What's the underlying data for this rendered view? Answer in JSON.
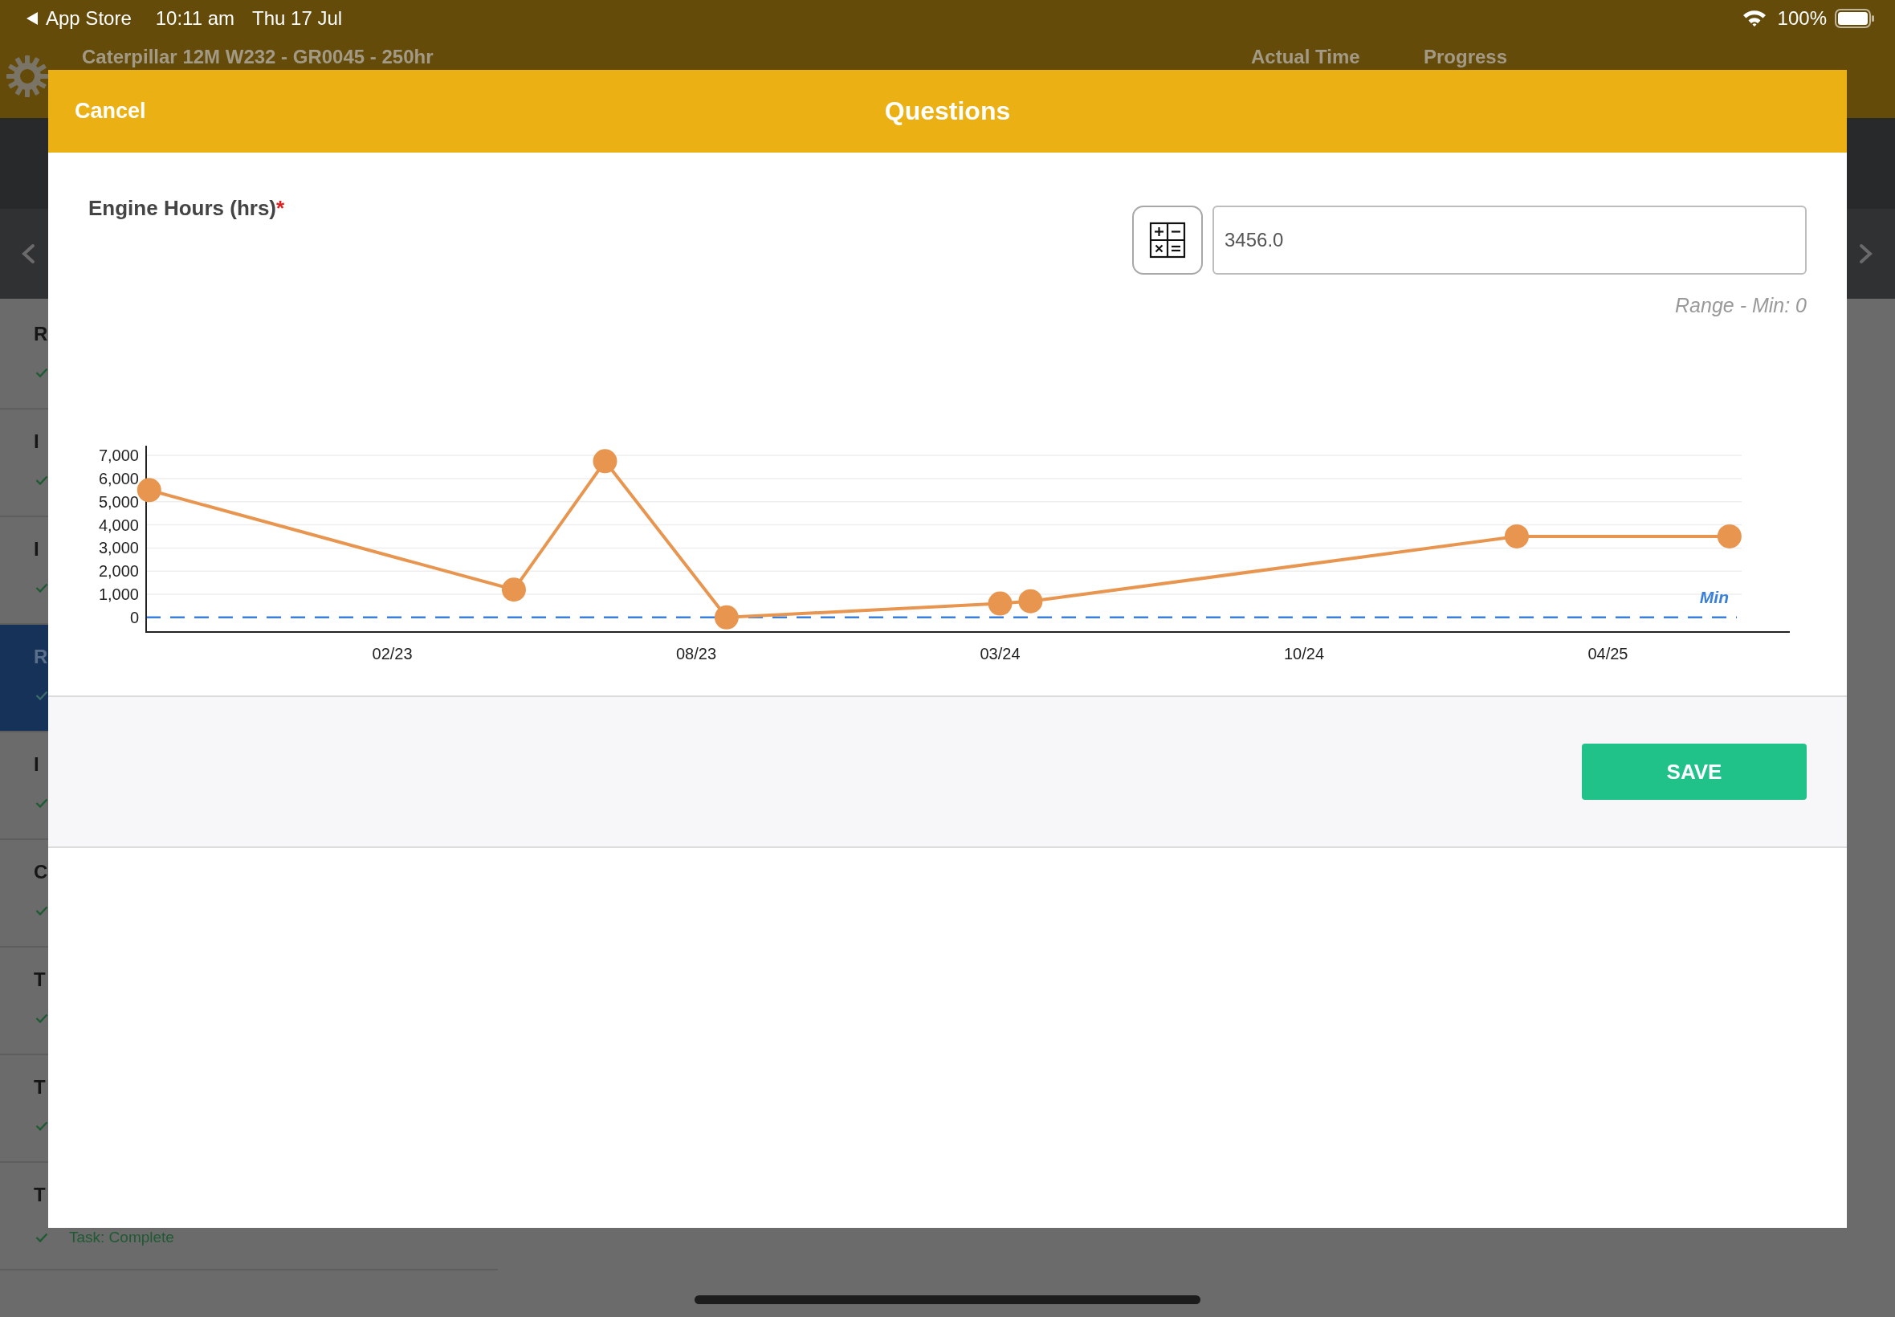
{
  "status_bar": {
    "back_label": "App Store",
    "time": "10:11 am",
    "date": "Thu 17 Jul",
    "battery": "100%"
  },
  "background": {
    "title": "Caterpillar 12M W232 - GR0045 - 250hr",
    "columns": [
      "Actual Time",
      "Progress"
    ],
    "rows": [
      {
        "title": "R",
        "selected": false
      },
      {
        "title": "I",
        "selected": false
      },
      {
        "title": "I",
        "selected": false
      },
      {
        "title": "R",
        "selected": true
      },
      {
        "title": "I",
        "selected": false
      },
      {
        "title": "C",
        "selected": false
      },
      {
        "title": "T",
        "selected": false
      },
      {
        "title": "T",
        "selected": false
      },
      {
        "title": "T",
        "selected": false,
        "status": "Task: Complete"
      }
    ]
  },
  "modal": {
    "cancel": "Cancel",
    "title": "Questions",
    "question": {
      "label": "Engine Hours (hrs)",
      "required_mark": "*",
      "value": "3456.0",
      "range": "Range - Min: 0"
    },
    "chart_data": {
      "type": "line",
      "categories": [
        null,
        null,
        null,
        null,
        null,
        null,
        null,
        null,
        "02/23",
        null,
        null,
        null,
        null,
        null,
        null,
        null,
        null,
        null,
        "08/23",
        null,
        null,
        null,
        null,
        null,
        null,
        null,
        null,
        null,
        "03/24",
        null,
        null,
        null,
        null,
        null,
        null,
        null,
        null,
        null,
        "10/24",
        null,
        null,
        null,
        null,
        null,
        null,
        null,
        null,
        null,
        "04/25",
        null,
        null,
        null,
        null
      ],
      "series": [
        {
          "color": "#e8964f",
          "marker": "circle",
          "values": [
            5500,
            null,
            null,
            null,
            null,
            null,
            null,
            null,
            null,
            null,
            null,
            null,
            1200,
            null,
            null,
            6750,
            null,
            null,
            null,
            0,
            null,
            null,
            null,
            null,
            null,
            null,
            null,
            null,
            600,
            700,
            null,
            null,
            null,
            null,
            null,
            null,
            null,
            null,
            null,
            null,
            null,
            null,
            null,
            null,
            null,
            3500,
            null,
            null,
            null,
            null,
            null,
            null,
            3500
          ]
        }
      ],
      "ylim": [
        -630,
        7420
      ],
      "grid": true,
      "yticks": [
        {
          "value": 0,
          "label": "0"
        },
        {
          "value": 1000,
          "label": "1,000"
        },
        {
          "value": 2000,
          "label": "2,000"
        },
        {
          "value": 3000,
          "label": "3,000"
        },
        {
          "value": 4000,
          "label": "4,000"
        },
        {
          "value": 5000,
          "label": "5,000"
        },
        {
          "value": 6000,
          "label": "6,000"
        },
        {
          "value": 7000,
          "label": "7,000"
        }
      ],
      "ref_lines": [
        {
          "axis": "y",
          "value": 0,
          "label": "Min",
          "color": "#3a7fd9"
        }
      ]
    },
    "save": "SAVE"
  }
}
